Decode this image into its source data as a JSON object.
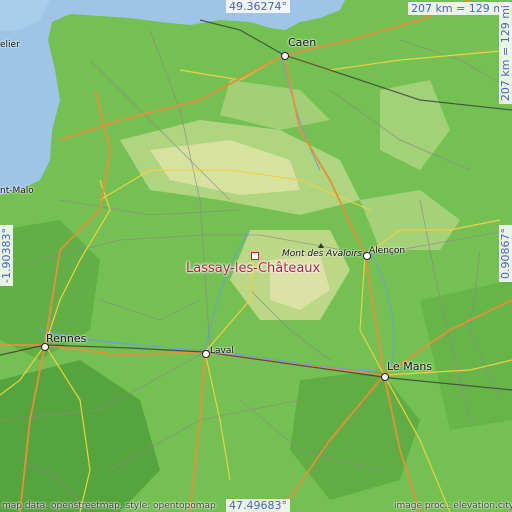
{
  "coordinates": {
    "top_latitude": "49.36274°",
    "bottom_latitude": "47.49683°",
    "left_longitude": "-1.90383°",
    "right_longitude": "0.90867°",
    "scale_horizontal": "207 km = 129 mi",
    "scale_vertical": "207 km = 129 mi"
  },
  "place": {
    "name": "Lassay-les-Châteaux"
  },
  "cities": {
    "caen": "Caen",
    "rennes": "Rennes",
    "laval": "Laval",
    "le_mans": "Le Mans",
    "alencon": "Alençon",
    "saint_malo": "nt-Malo",
    "cherbourg": "elier"
  },
  "peak": {
    "name": "Mont des Avaloirs"
  },
  "credits": {
    "left": "map data: openstreetmap, style: opentopomap",
    "right": "image proc.: elevation.city"
  },
  "colors": {
    "sea": "#9ec5e6",
    "lowland": "#6fbd4e",
    "upland": "#c9dd92",
    "highland": "#e8e6b4",
    "marker": "#c0203a",
    "coord_text": "#4a63c8"
  }
}
